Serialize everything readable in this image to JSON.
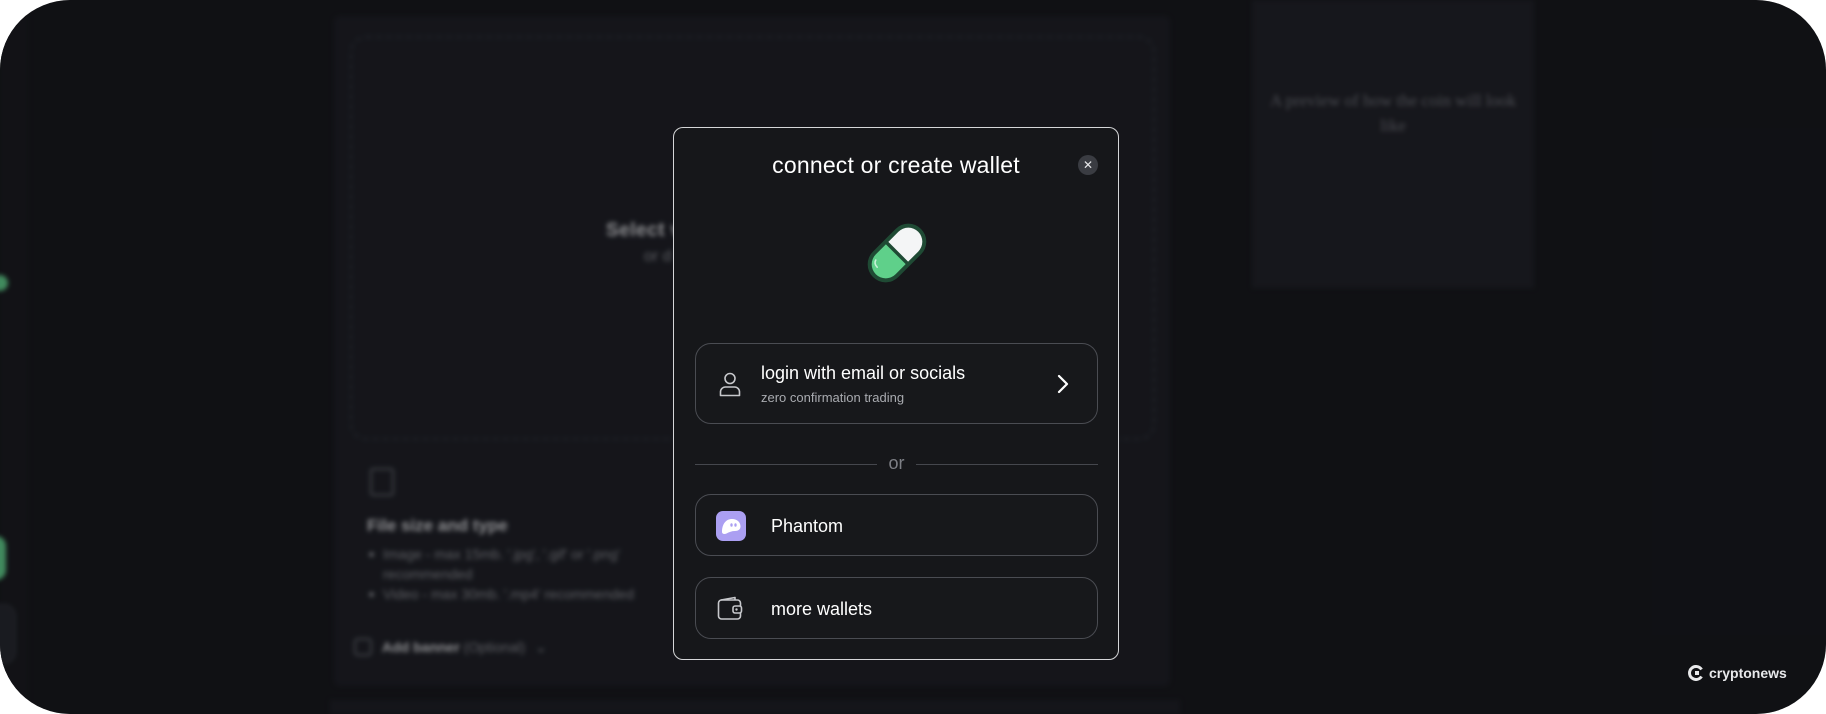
{
  "background": {
    "dropzone_title": "Select v",
    "dropzone_sub": "or d",
    "file_section_title": "File size and type",
    "file_list": [
      "Image - max 15mb. '.jpg', '.gif' or '.png'",
      "recommended",
      "Video - max 30mb. '.mp4' recommended"
    ],
    "banner_label": "Add banner",
    "banner_optional": "(Optional)",
    "preview_text": "A preview of how the coin will look like"
  },
  "modal": {
    "title": "connect or create wallet",
    "close_symbol": "✕",
    "login": {
      "title": "login with email or socials",
      "subtitle": "zero confirmation trading"
    },
    "divider_text": "or",
    "phantom_label": "Phantom",
    "more_wallets_label": "more wallets"
  },
  "watermark": {
    "text": "cryptonews"
  },
  "colors": {
    "modal_bg": "#16171a",
    "modal_border": "#d5d6d8",
    "pill_green": "#5fd08a",
    "phantom_purple": "#ab9ff2",
    "page_bg": "#15161a"
  },
  "icons": {
    "logo": "pill-logo-icon",
    "login": "user-icon",
    "chevron": "chevron-right-icon",
    "phantom": "phantom-ghost-icon",
    "more_wallets": "wallet-icon",
    "close": "close-icon"
  }
}
